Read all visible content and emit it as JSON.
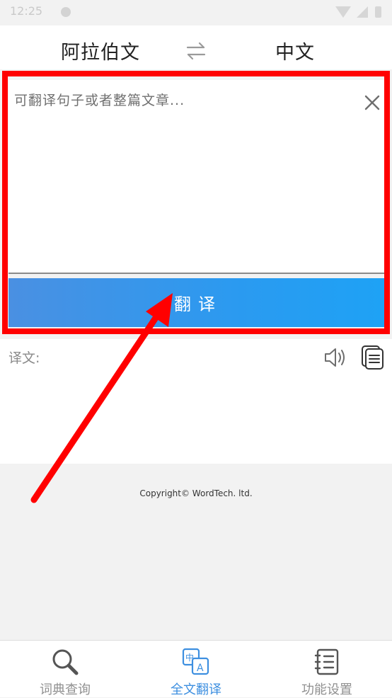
{
  "status_bar": {
    "time": "12:25"
  },
  "header": {
    "source_language": "阿拉伯文",
    "target_language": "中文",
    "swap_icon": "swap-arrows-icon"
  },
  "input": {
    "placeholder": "可翻译句子或者整篇文章...",
    "value": "",
    "clear_icon": "close-icon"
  },
  "translate_button": {
    "label": "翻译"
  },
  "result": {
    "label": "译文:",
    "speaker_icon": "speaker-icon",
    "copy_icon": "copy-icon"
  },
  "footer": {
    "copyright": "Copyright© WordTech. ltd."
  },
  "annotation": {
    "box_color": "#ff0000",
    "arrow_color": "#ff0000"
  },
  "bottom_nav": {
    "items": [
      {
        "label": "词典查询",
        "icon": "search-icon",
        "active": false
      },
      {
        "label": "全文翻译",
        "icon": "translate-icon",
        "active": true
      },
      {
        "label": "功能设置",
        "icon": "notebook-icon",
        "active": false
      }
    ],
    "active_color": "#3d8fe0",
    "inactive_color": "#909090"
  }
}
